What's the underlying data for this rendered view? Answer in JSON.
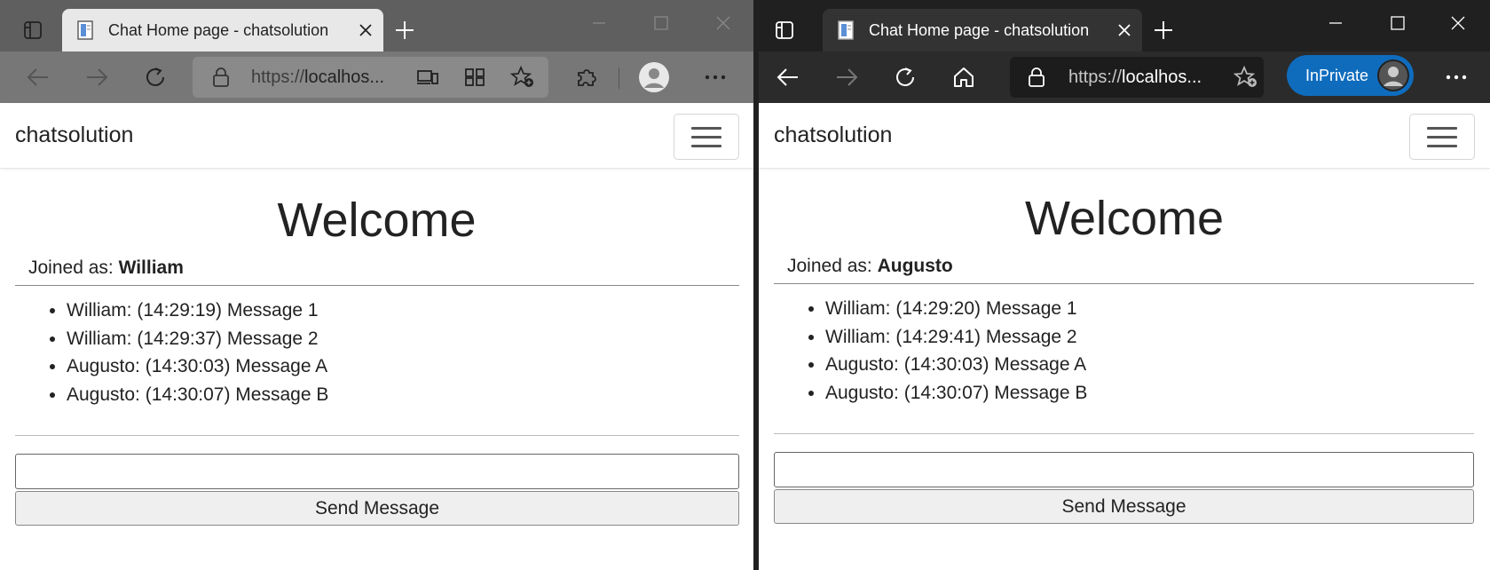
{
  "colors": {
    "win1_titlebar": "#5f5f5f",
    "win1_toolbar": "#777777",
    "win1_tab": "#e8e8e8",
    "win2_titlebar": "#202020",
    "win2_toolbar": "#2b2b2b",
    "win2_tab": "#333333",
    "inprivate_blue": "#0f6cbd"
  },
  "window1": {
    "tab_title": "Chat Home page - chatsolution",
    "address": "https://localhos...",
    "address_prefix": "https://",
    "address_host": "localhos...",
    "page": {
      "brand": "chatsolution",
      "heading": "Welcome",
      "joined_label": "Joined as:",
      "joined_user": "William",
      "messages": [
        "William: (14:29:19) Message 1",
        "William: (14:29:37) Message 2",
        "Augusto: (14:30:03) Message A",
        "Augusto: (14:30:07) Message B"
      ],
      "input_value": "",
      "send_label": "Send Message"
    }
  },
  "window2": {
    "tab_title": "Chat Home page - chatsolution",
    "address_prefix": "https://",
    "address_host": "localhos...",
    "inprivate_label": "InPrivate",
    "page": {
      "brand": "chatsolution",
      "heading": "Welcome",
      "joined_label": "Joined as:",
      "joined_user": "Augusto",
      "messages": [
        "William: (14:29:20) Message 1",
        "William: (14:29:41) Message 2",
        "Augusto: (14:30:03) Message A",
        "Augusto: (14:30:07) Message B"
      ],
      "input_value": "",
      "send_label": "Send Message"
    }
  },
  "icons": [
    "tab-actions-icon",
    "page-favicon",
    "close-tab-icon",
    "new-tab-icon",
    "minimize-icon",
    "maximize-icon",
    "close-window-icon",
    "back-icon",
    "forward-icon",
    "refresh-icon",
    "home-icon",
    "lock-icon",
    "devices-icon",
    "apps-icon",
    "add-favorite-icon",
    "extensions-icon",
    "profile-icon",
    "more-icon",
    "menu-toggler-icon"
  ]
}
